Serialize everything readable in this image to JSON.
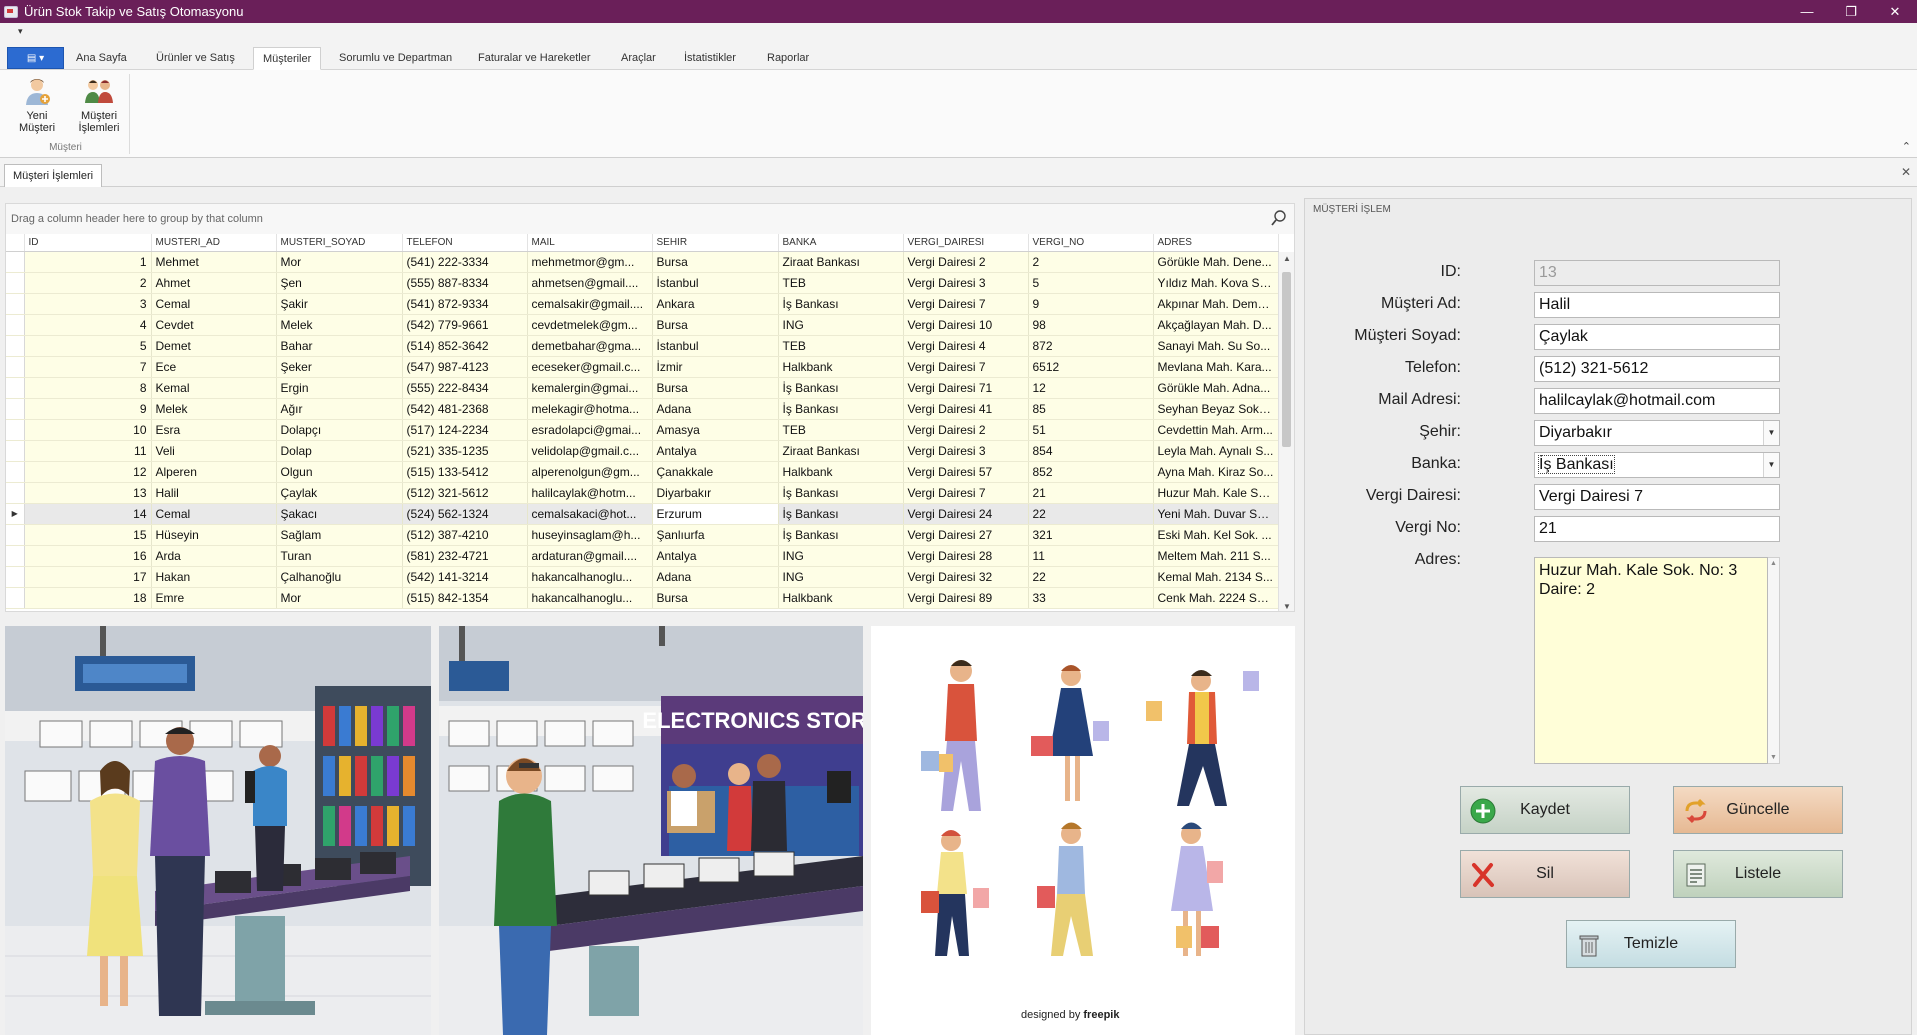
{
  "window": {
    "title": "Ürün Stok Takip ve Satış Otomasyonu",
    "controls": [
      "minimize-icon",
      "restore-icon",
      "close-icon"
    ]
  },
  "ribbon": {
    "tabs": [
      "Ana Sayfa",
      "Ürünler ve Satış",
      "Müşteriler",
      "Sorumlu ve Departman",
      "Faturalar ve Hareketler",
      "Araçlar",
      "İstatistikler",
      "Raporlar"
    ],
    "active_tab": "Müşteriler",
    "group_caption": "Müşteri",
    "buttons": [
      {
        "label": "Yeni Müşteri",
        "icon": "add-customer-icon"
      },
      {
        "label": "Müşteri İşlemleri",
        "icon": "customers-group-icon"
      }
    ]
  },
  "document_tab": "Müşteri İşlemleri",
  "grid": {
    "group_hint": "Drag a column header here to group by that column",
    "columns": [
      "ID",
      "MUSTERI_AD",
      "MUSTERI_SOYAD",
      "TELEFON",
      "MAIL",
      "SEHIR",
      "BANKA",
      "VERGI_DAIRESI",
      "VERGI_NO",
      "ADRES"
    ],
    "selected_row": 12,
    "rows": [
      [
        "1",
        "Mehmet",
        "Mor",
        "(541) 222-3334",
        "mehmetmor@gm...",
        "Bursa",
        "Ziraat Bankası",
        "Vergi Dairesi 2",
        "2",
        "Görükle Mah. Dene..."
      ],
      [
        "2",
        "Ahmet",
        "Şen",
        "(555) 887-8334",
        "ahmetsen@gmail....",
        "İstanbul",
        "TEB",
        "Vergi Dairesi 3",
        "5",
        "Yıldız Mah. Kova So..."
      ],
      [
        "3",
        "Cemal",
        "Şakir",
        "(541) 872-9334",
        "cemalsakir@gmail....",
        "Ankara",
        "İş Bankası",
        "Vergi Dairesi 7",
        "9",
        "Akpınar Mah. Deme..."
      ],
      [
        "4",
        "Cevdet",
        "Melek",
        "(542) 779-9661",
        "cevdetmelek@gm...",
        "Bursa",
        "ING",
        "Vergi Dairesi 10",
        "98",
        "Akçağlayan Mah. D..."
      ],
      [
        "5",
        "Demet",
        "Bahar",
        "(514) 852-3642",
        "demetbahar@gma...",
        "İstanbul",
        "TEB",
        "Vergi Dairesi 4",
        "872",
        "Sanayi Mah. Su So..."
      ],
      [
        "7",
        "Ece",
        "Şeker",
        "(547) 987-4123",
        "eceseker@gmail.c...",
        "İzmir",
        "Halkbank",
        "Vergi Dairesi 7",
        "6512",
        "Mevlana Mah. Kara..."
      ],
      [
        "8",
        "Kemal",
        "Ergin",
        "(555) 222-8434",
        "kemalergin@gmai...",
        "Bursa",
        "İş Bankası",
        "Vergi Dairesi 71",
        "12",
        "Görükle Mah. Adna..."
      ],
      [
        "9",
        "Melek",
        "Ağır",
        "(542) 481-2368",
        "melekagir@hotma...",
        "Adana",
        "İş Bankası",
        "Vergi Dairesi 41",
        "85",
        "Seyhan Beyaz Sok. ..."
      ],
      [
        "10",
        "Esra",
        "Dolapçı",
        "(517) 124-2234",
        "esradolapci@gmai...",
        "Amasya",
        "TEB",
        "Vergi Dairesi 2",
        "51",
        "Cevdettin Mah. Arm..."
      ],
      [
        "11",
        "Veli",
        "Dolap",
        "(521) 335-1235",
        "velidolap@gmail.c...",
        "Antalya",
        "Ziraat Bankası",
        "Vergi Dairesi 3",
        "854",
        "Leyla Mah. Aynalı S..."
      ],
      [
        "12",
        "Alperen",
        "Olgun",
        "(515) 133-5412",
        "alperenolgun@gm...",
        "Çanakkale",
        "Halkbank",
        "Vergi Dairesi 57",
        "852",
        "Ayna Mah. Kiraz So..."
      ],
      [
        "13",
        "Halil",
        "Çaylak",
        "(512) 321-5612",
        "halilcaylak@hotm...",
        "Diyarbakır",
        "İş Bankası",
        "Vergi Dairesi 7",
        "21",
        "Huzur Mah. Kale Sok..."
      ],
      [
        "14",
        "Cemal",
        "Şakacı",
        "(524) 562-1324",
        "cemalsakaci@hot...",
        "Erzurum",
        "İş Bankası",
        "Vergi Dairesi 24",
        "22",
        "Yeni Mah. Duvar So..."
      ],
      [
        "15",
        "Hüseyin",
        "Sağlam",
        "(512) 387-4210",
        "huseyinsaglam@h...",
        "Şanlıurfa",
        "İş Bankası",
        "Vergi Dairesi 27",
        "321",
        "Eski Mah. Kel Sok. ..."
      ],
      [
        "16",
        "Arda",
        "Turan",
        "(581) 232-4721",
        "ardaturan@gmail....",
        "Antalya",
        "ING",
        "Vergi Dairesi 28",
        "11",
        "Meltem Mah. 211 S..."
      ],
      [
        "17",
        "Hakan",
        "Çalhanoğlu",
        "(542) 141-3214",
        "hakancalhanoglu...",
        "Adana",
        "ING",
        "Vergi Dairesi 32",
        "22",
        "Kemal Mah. 2134 S..."
      ],
      [
        "18",
        "Emre",
        "Mor",
        "(515) 842-1354",
        "hakancalhanoglu...",
        "Bursa",
        "Halkbank",
        "Vergi Dairesi 89",
        "33",
        "Cenk Mah. 2224 So..."
      ]
    ]
  },
  "images": {
    "store_sign": "ELECTRONICS STORE",
    "credit_prefix": "designed by",
    "credit_brand": "freepik"
  },
  "form": {
    "caption": "MÜŞTERİ İŞLEM",
    "labels": {
      "id": "ID:",
      "ad": "Müşteri Ad:",
      "soyad": "Müşteri Soyad:",
      "telefon": "Telefon:",
      "mail": "Mail Adresi:",
      "sehir": "Şehir:",
      "banka": "Banka:",
      "vergi_dairesi": "Vergi Dairesi:",
      "vergi_no": "Vergi No:",
      "adres": "Adres:"
    },
    "values": {
      "id": "13",
      "ad": "Halil",
      "soyad": "Çaylak",
      "telefon": "(512) 321-5612",
      "mail": "halilcaylak@hotmail.com",
      "sehir": "Diyarbakır",
      "banka": "İş Bankası",
      "vergi_dairesi": "Vergi Dairesi 7",
      "vergi_no": "21",
      "adres": "Huzur Mah. Kale Sok. No: 3\nDaire: 2"
    },
    "buttons": {
      "kaydet": "Kaydet",
      "guncelle": "Güncelle",
      "sil": "Sil",
      "listele": "Listele",
      "temizle": "Temizle"
    }
  }
}
